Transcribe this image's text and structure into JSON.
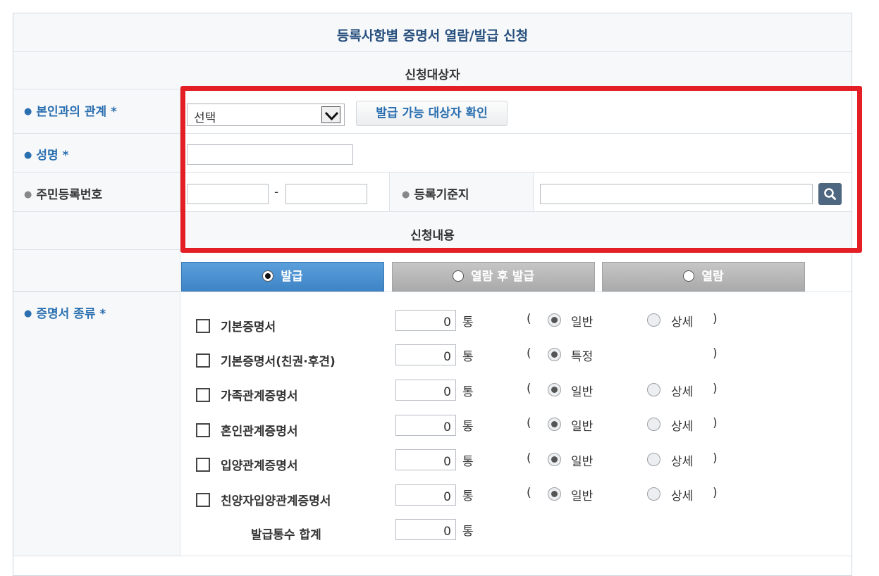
{
  "title": "등록사항별 증명서 열람/발급 신청",
  "section_applicant": "신청대상자",
  "section_content": "신청내용",
  "relation": {
    "label": "본인과의 관계 *",
    "select_value": "선택",
    "check_button": "발급 가능 대상자 확인"
  },
  "name": {
    "label": "성명 *",
    "value": ""
  },
  "rrn": {
    "label": "주민등록번호",
    "first": "",
    "separator": "-",
    "second": ""
  },
  "registry": {
    "label": "등록기준지",
    "value": "",
    "search_icon": "magnifier-icon"
  },
  "tabs": [
    {
      "label": "발급",
      "selected": true
    },
    {
      "label": "열람 후 발급",
      "selected": false
    },
    {
      "label": "열람",
      "selected": false
    }
  ],
  "cert_type_label": "증명서 종류 *",
  "certificates": [
    {
      "name": "기본증명서",
      "qty": "0",
      "unit": "통",
      "open": "(",
      "opt1": "일반",
      "opt2": "상세",
      "close": ")"
    },
    {
      "name": "기본증명서(친권·후견)",
      "qty": "0",
      "unit": "통",
      "open": "(",
      "opt1": "특정",
      "opt2": "",
      "close": ")"
    },
    {
      "name": "가족관계증명서",
      "qty": "0",
      "unit": "통",
      "open": "(",
      "opt1": "일반",
      "opt2": "상세",
      "close": ")"
    },
    {
      "name": "혼인관계증명서",
      "qty": "0",
      "unit": "통",
      "open": "(",
      "opt1": "일반",
      "opt2": "상세",
      "close": ")"
    },
    {
      "name": "입양관계증명서",
      "qty": "0",
      "unit": "통",
      "open": "(",
      "opt1": "일반",
      "opt2": "상세",
      "close": ")"
    },
    {
      "name": "친양자입양관계증명서",
      "qty": "0",
      "unit": "통",
      "open": "(",
      "opt1": "일반",
      "opt2": "상세",
      "close": ")"
    }
  ],
  "total": {
    "label": "발급통수 합계",
    "qty": "0",
    "unit": "통"
  },
  "colors": {
    "title": "#27507e",
    "accent_blue": "#2a6fb0",
    "highlight_red": "#e31e25",
    "tab_active": "#4a90d0",
    "tab_inactive": "#b8b8b8"
  }
}
